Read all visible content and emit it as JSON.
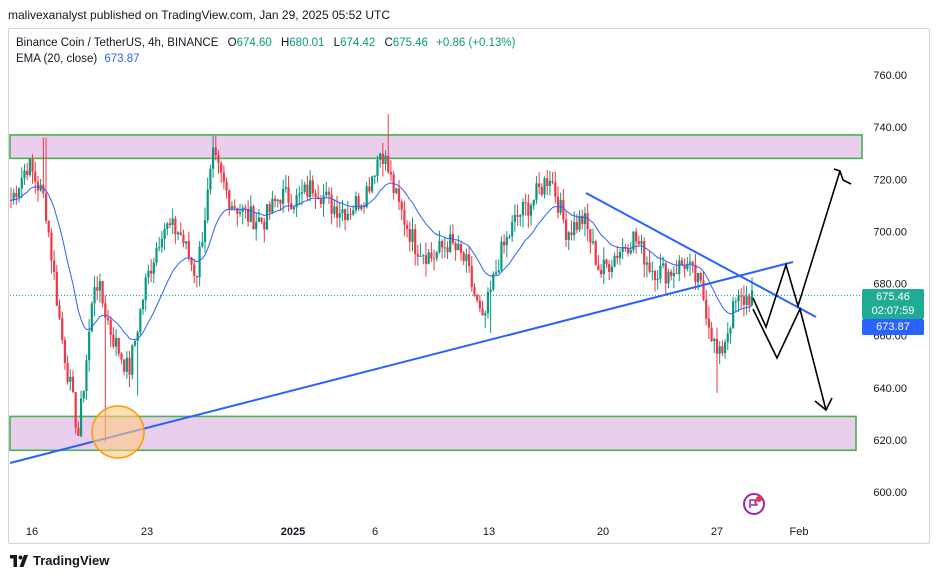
{
  "header": {
    "published_text": "malivexanalyst published on TradingView.com, Jan 29, 2025 05:52 UTC"
  },
  "legend": {
    "symbol": "Binance Coin / TetherUS, 4h, BINANCE",
    "open_label": "O",
    "open_value": "674.60",
    "high_label": "H",
    "high_value": "680.01",
    "low_label": "L",
    "low_value": "674.42",
    "close_label": "C",
    "close_value": "675.46",
    "change_value": "+0.86 (+0.13%)",
    "ema_label": "EMA (20, close)",
    "ema_value": "673.87"
  },
  "price_tag": {
    "price": "675.46",
    "countdown": "02:07:59"
  },
  "ema_tag": {
    "value": "673.87"
  },
  "footer": {
    "brand": "TradingView"
  },
  "colors": {
    "up": "#089981",
    "down": "#f23645",
    "ema": "#2962ff",
    "trendline": "#2962ff",
    "zone_fill": "#e1bee7",
    "zone_border": "#4caf50",
    "circle": "#ff9800"
  },
  "chart_data": {
    "type": "candlestick",
    "symbol": "BNBUSDT",
    "timeframe": "4h",
    "ylim": [
      590,
      768
    ],
    "y_ticks": [
      "760.00",
      "740.00",
      "720.00",
      "700.00",
      "680.00",
      "660.00",
      "640.00",
      "620.00",
      "600.00"
    ],
    "x_ticks": [
      "16",
      "23",
      "2025",
      "6",
      "13",
      "20",
      "27",
      "Feb"
    ],
    "price_path": [
      [
        "16",
        712
      ],
      [
        "17",
        726
      ],
      [
        "18",
        712
      ],
      [
        "19",
        660
      ],
      [
        "20",
        622
      ],
      [
        "21",
        683
      ],
      [
        "22",
        660
      ],
      [
        "23",
        646
      ],
      [
        "24",
        680
      ],
      [
        "25",
        702
      ],
      [
        "26",
        700
      ],
      [
        "27",
        683
      ],
      [
        "28",
        728
      ],
      [
        "29",
        712
      ],
      [
        "30",
        706
      ],
      [
        "31",
        704
      ],
      [
        "2025",
        714
      ],
      [
        "2",
        712
      ],
      [
        "3",
        718
      ],
      [
        "4",
        710
      ],
      [
        "5",
        708
      ],
      [
        "6",
        714
      ],
      [
        "7",
        732
      ],
      [
        "8",
        710
      ],
      [
        "9",
        695
      ],
      [
        "10",
        690
      ],
      [
        "11",
        696
      ],
      [
        "12",
        688
      ],
      [
        "13",
        664
      ],
      [
        "14",
        690
      ],
      [
        "15",
        705
      ],
      [
        "16b",
        712
      ],
      [
        "17b",
        722
      ],
      [
        "18b",
        700
      ],
      [
        "19b",
        705
      ],
      [
        "20",
        684
      ],
      [
        "21",
        692
      ],
      [
        "22",
        698
      ],
      [
        "23b",
        686
      ],
      [
        "24b",
        684
      ],
      [
        "25b",
        688
      ],
      [
        "26b",
        678
      ],
      [
        "27",
        650
      ],
      [
        "28b",
        672
      ],
      [
        "29b",
        675.46
      ]
    ],
    "zones": [
      {
        "name": "resistance",
        "top": 737,
        "bottom": 728
      },
      {
        "name": "support",
        "top": 629,
        "bottom": 616
      }
    ],
    "trendlines": [
      {
        "name": "ascending",
        "from": [
          "12/15",
          612
        ],
        "to": [
          "Jan 31",
          689
        ]
      },
      {
        "name": "descending",
        "from": [
          "Jan 18",
          715
        ],
        "to": [
          "Feb 1",
          668
        ]
      }
    ],
    "projections": [
      {
        "name": "bullish",
        "points": [
          662,
          688,
          670,
          722
        ]
      },
      {
        "name": "bearish",
        "points": [
          652,
          670,
          632
        ]
      }
    ]
  }
}
